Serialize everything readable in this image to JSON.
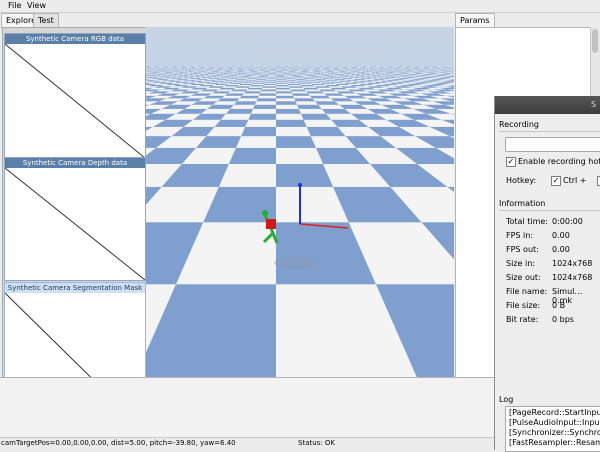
{
  "menu": [
    "File",
    "View"
  ],
  "left_tabs": [
    "Explorer",
    "Test"
  ],
  "camera_panels": [
    {
      "title": "Synthetic Camera RGB data"
    },
    {
      "title": "Synthetic Camera Depth data"
    },
    {
      "title": "Synthetic Camera Segmentation Mask"
    }
  ],
  "right_tab": "Params",
  "status": {
    "camera": "camTargetPos=0.00,0.00,0.00, dist=5.00, pitch=-39.80, yaw=6.40",
    "state": "Status: OK"
  },
  "recorder": {
    "title_fragment": "S",
    "recording_label": "Recording",
    "enable_hotkey_label": "Enable recording hot",
    "enable_hotkey_checked": true,
    "hotkey_label": "Hotkey:",
    "ctrl_label": "Ctrl +",
    "ctrl_checked": true,
    "information_label": "Information",
    "info": [
      {
        "label": "Total time:",
        "value": "0:00:00"
      },
      {
        "label": "FPS in:",
        "value": "0.00"
      },
      {
        "label": "FPS out:",
        "value": "0.00"
      },
      {
        "label": "Size in:",
        "value": "1024x768"
      },
      {
        "label": "Size out:",
        "value": "1024x768"
      },
      {
        "label": "File name:",
        "value": "Simul…0.mk"
      },
      {
        "label": "File size:",
        "value": "0 B"
      },
      {
        "label": "Bit rate:",
        "value": "0 bps"
      }
    ],
    "log_label": "Log",
    "log_lines": [
      "[PageRecord::StartInput",
      "[PulseAudioInput::Input",
      "[Synchronizer::Synchro",
      "[FastResampler::Resam"
    ]
  },
  "colors": {
    "checker_light": "#f4f4f4",
    "checker_dark": "#7f9fcf",
    "panel_header": "#5a7fa8",
    "axis_x": "#e02020",
    "axis_y": "#20b030",
    "axis_z": "#2030e0"
  }
}
